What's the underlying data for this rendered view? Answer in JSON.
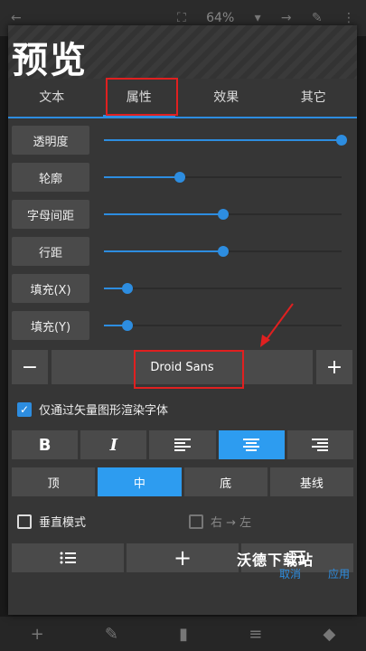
{
  "background": {
    "zoom_text": "64%",
    "toolbar_icons": [
      "back-icon",
      "fit-icon",
      "zoom-dropdown-icon",
      "next-icon",
      "edit-icon",
      "more-icon"
    ],
    "bottom_icons": [
      "add-icon",
      "pencil-icon",
      "trash-icon",
      "menu-icon",
      "layers-icon"
    ]
  },
  "dialog": {
    "title": "预览",
    "tabs": [
      {
        "label": "文本"
      },
      {
        "label": "属性"
      },
      {
        "label": "效果"
      },
      {
        "label": "其它"
      }
    ],
    "active_tab": 1,
    "properties": [
      {
        "label": "透明度",
        "value": 1.0
      },
      {
        "label": "轮廓",
        "value": 0.32
      },
      {
        "label": "字母间距",
        "value": 0.5
      },
      {
        "label": "行距",
        "value": 0.5
      },
      {
        "label": "填充(X)",
        "value": 0.1
      },
      {
        "label": "填充(Y)",
        "value": 0.1
      }
    ],
    "font": {
      "minus": "−",
      "name": "Droid Sans",
      "plus": "+"
    },
    "vector_render": {
      "label": "仅通过矢量图形渲染字体",
      "checked": true
    },
    "style_buttons": {
      "bold": "B",
      "italic": "I"
    },
    "vertical_align": [
      {
        "label": "顶",
        "selected": false
      },
      {
        "label": "中",
        "selected": true
      },
      {
        "label": "底",
        "selected": false
      },
      {
        "label": "基线",
        "selected": false
      }
    ],
    "vertical_mode": {
      "label": "垂直模式",
      "checked": false
    },
    "rtl": {
      "label": "右 → 左",
      "checked": false
    },
    "cancel": "取消",
    "apply": "应用"
  },
  "watermark": "沃德下载站",
  "colors": {
    "accent": "#2d8de0",
    "selected": "#2d9cf0",
    "annotation": "#e02020"
  }
}
